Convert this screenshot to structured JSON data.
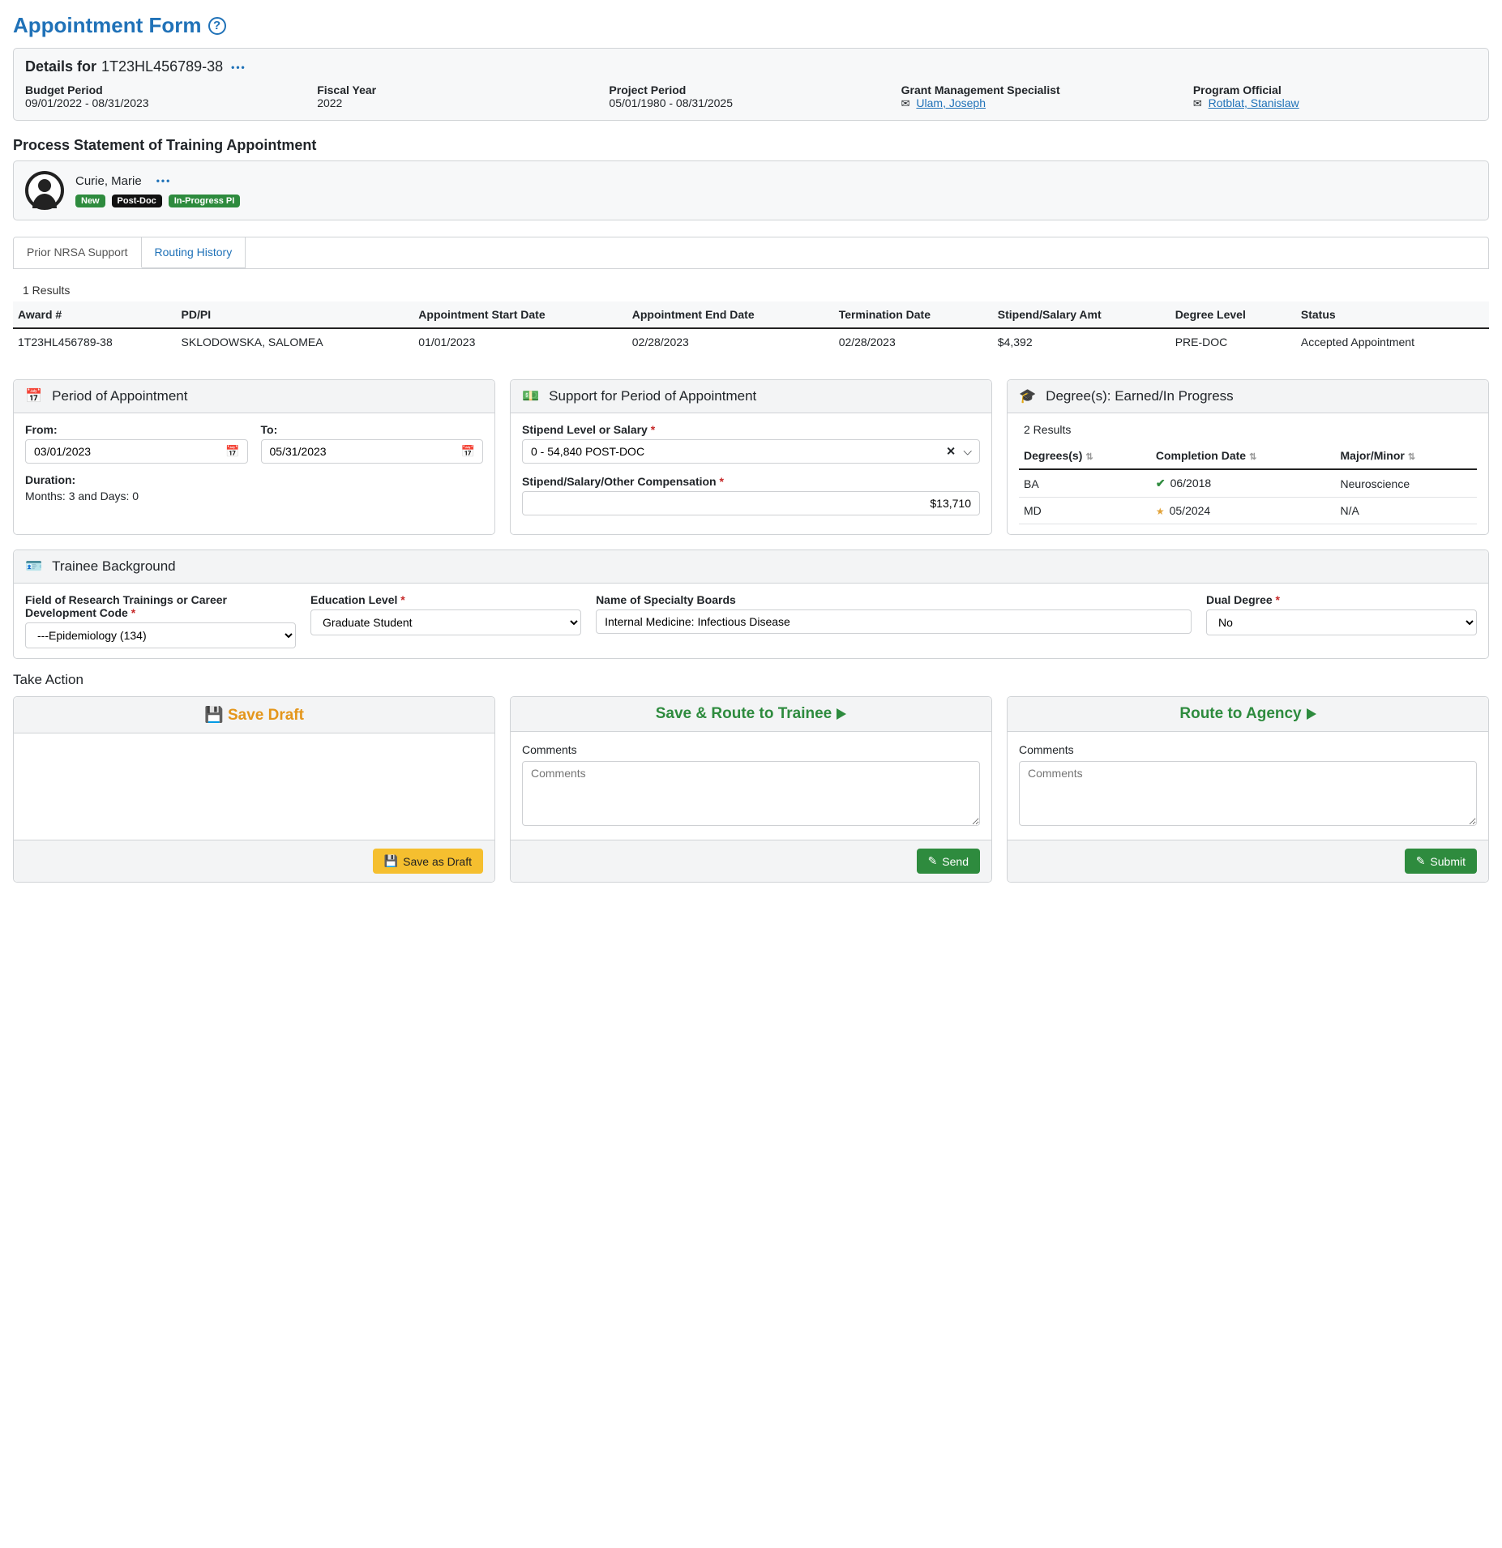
{
  "page": {
    "title": "Appointment Form"
  },
  "grant": {
    "details_for": "Details for",
    "id": "1T23HL456789-38",
    "fields": {
      "budget_period": {
        "label": "Budget Period",
        "value": "09/01/2022 - 08/31/2023"
      },
      "fiscal_year": {
        "label": "Fiscal Year",
        "value": "2022"
      },
      "project_period": {
        "label": "Project Period",
        "value": "05/01/1980 - 08/31/2025"
      },
      "gms": {
        "label": "Grant Management Specialist",
        "value": "Ulam, Joseph"
      },
      "po": {
        "label": "Program Official",
        "value": "Rotblat, Stanislaw"
      }
    }
  },
  "appointment": {
    "heading": "Process Statement of Training Appointment",
    "person": "Curie, Marie",
    "badges": [
      "New",
      "Post-Doc",
      "In-Progress PI"
    ]
  },
  "tabs": {
    "prior": "Prior NRSA Support",
    "routing": "Routing History"
  },
  "prior_support": {
    "count_label": "1 Results",
    "cols": [
      "Award #",
      "PD/PI",
      "Appointment Start Date",
      "Appointment End Date",
      "Termination Date",
      "Stipend/Salary Amt",
      "Degree Level",
      "Status"
    ],
    "rows": [
      [
        "1T23HL456789-38",
        "SKLODOWSKA, SALOMEA",
        "01/01/2023",
        "02/28/2023",
        "02/28/2023",
        "$4,392",
        "PRE-DOC",
        "Accepted Appointment"
      ]
    ]
  },
  "period": {
    "title": "Period of Appointment",
    "from_label": "From:",
    "from_value": "03/01/2023",
    "to_label": "To:",
    "to_value": "05/31/2023",
    "duration_label": "Duration:",
    "duration_value": "Months: 3 and Days: 0"
  },
  "support": {
    "title": "Support for Period of Appointment",
    "stipend_level_label": "Stipend Level or Salary",
    "stipend_level_value": "0 - 54,840 POST-DOC",
    "comp_label": "Stipend/Salary/Other Compensation",
    "comp_value": "$13,710"
  },
  "degrees": {
    "title": "Degree(s): Earned/In Progress",
    "count_label": "2 Results",
    "cols": [
      "Degrees(s)",
      "Completion Date",
      "Major/Minor"
    ],
    "rows": [
      {
        "deg": "BA",
        "date": "06/2018",
        "done": true,
        "major": "Neuroscience"
      },
      {
        "deg": "MD",
        "date": "05/2024",
        "done": false,
        "major": "N/A"
      }
    ]
  },
  "background": {
    "title": "Trainee Background",
    "field_label": "Field of Research Trainings or Career Development Code",
    "field_value": "---Epidemiology (134)",
    "edu_label": "Education Level",
    "edu_value": "Graduate Student",
    "boards_label": "Name of Specialty Boards",
    "boards_value": "Internal Medicine: Infectious Disease",
    "dual_label": "Dual Degree",
    "dual_value": "No"
  },
  "actions": {
    "heading": "Take Action",
    "save_draft_title": "Save Draft",
    "save_draft_btn": "Save as Draft",
    "route_trainee_title": "Save & Route to Trainee",
    "route_agency_title": "Route to Agency",
    "comments_label": "Comments",
    "comments_placeholder": "Comments",
    "send_btn": "Send",
    "submit_btn": "Submit"
  }
}
